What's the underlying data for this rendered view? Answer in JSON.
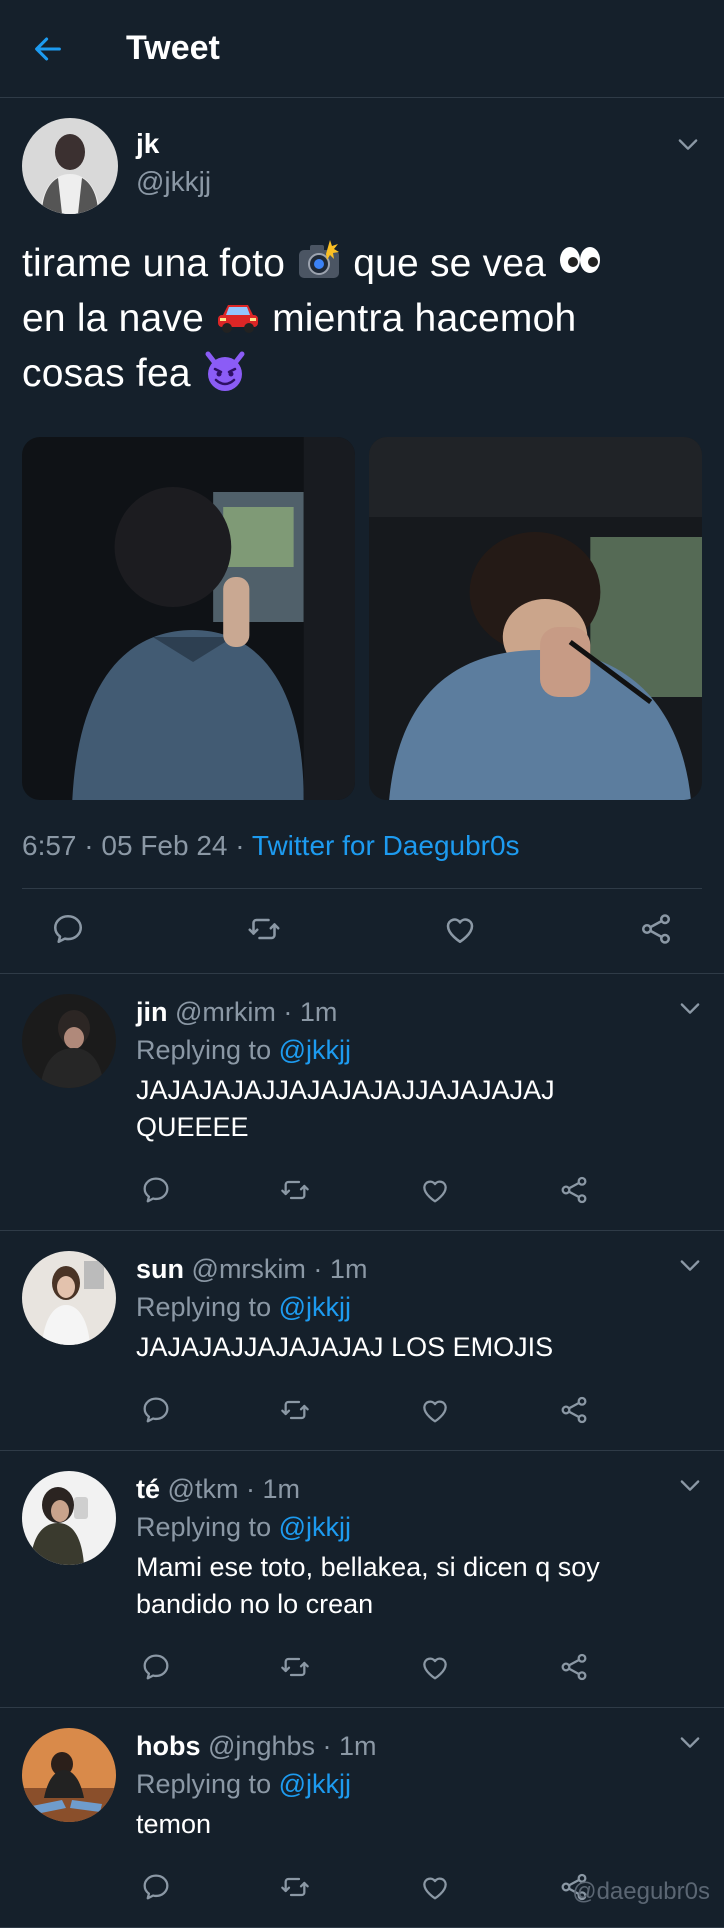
{
  "header": {
    "title": "Tweet"
  },
  "tweet": {
    "author_name": "jk",
    "author_handle": "@jkkjj",
    "text_parts": [
      "tirame una foto",
      "que se vea",
      "en la nave",
      "mientra hacemoh",
      "cosas fea"
    ],
    "time": "6:57",
    "date": "05 Feb 24",
    "source": "Twitter for Daegubr0s"
  },
  "replies": [
    {
      "name": "jin",
      "handle": "@mrkim",
      "time": "1m",
      "replying_label": "Replying to",
      "mention": "@jkkjj",
      "text": "JAJAJAJAJJAJAJAJAJJAJAJAJAJ QUEEEE"
    },
    {
      "name": "sun",
      "handle": "@mrskim",
      "time": "1m",
      "replying_label": "Replying to",
      "mention": "@jkkjj",
      "text": "JAJAJAJJAJAJAJAJ LOS EMOJIS"
    },
    {
      "name": "té",
      "handle": "@tkm",
      "time": "1m",
      "replying_label": "Replying to",
      "mention": "@jkkjj",
      "text": "Mami ese toto, bellakea, si dicen q soy bandido no lo crean"
    },
    {
      "name": "hobs",
      "handle": "@jnghbs",
      "time": "1m",
      "replying_label": "Replying to",
      "mention": "@jkkjj",
      "text": "temon"
    }
  ],
  "watermark": "@daegubr0s",
  "colors": {
    "background": "#15202b",
    "accent": "#1d9bf0",
    "secondary_text": "#8b98a5",
    "divider": "#2f3b47"
  },
  "icons": [
    "back-arrow-icon",
    "chevron-down-icon",
    "reply-icon",
    "retweet-icon",
    "like-icon",
    "share-icon",
    "camera-flash-emoji",
    "eyes-emoji",
    "car-emoji",
    "smiling-devil-emoji"
  ]
}
